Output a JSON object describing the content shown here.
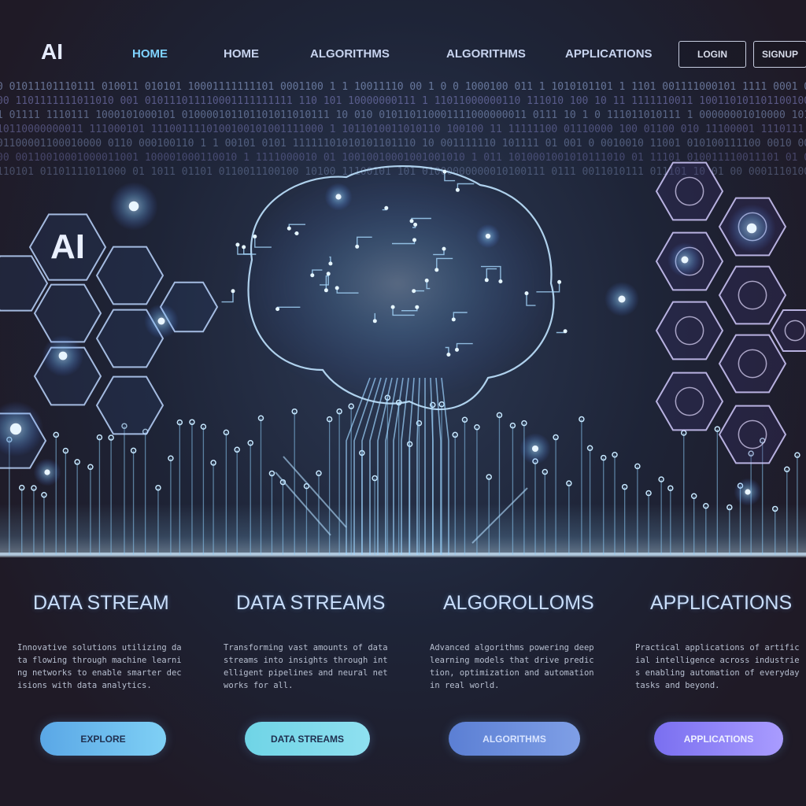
{
  "header": {
    "logo": "AI",
    "nav": [
      "HOME",
      "HOME",
      "ALGORITHMS",
      "ALGORITHMS",
      "APPLICATIONS"
    ],
    "buttons": [
      "LOGIN",
      "SIGNUP"
    ]
  },
  "hero": {
    "hex_badge": "AI"
  },
  "features": [
    {
      "title": "DATA STREAM",
      "description": "Innovative solutions utilizing data flowing through machine learning networks to enable smarter decisions with data analytics.",
      "button": "EXPLORE"
    },
    {
      "title": "DATA STREAMS",
      "description": "Transforming vast amounts of data streams into insights through intelligent pipelines and neural networks for all.",
      "button": "DATA STREAMS"
    },
    {
      "title": "ALGOROLLOMS",
      "description": "Advanced algorithms powering deep learning models that drive prediction, optimization and automation in real world.",
      "button": "ALGORITHMS"
    },
    {
      "title": "APPLICATIONS",
      "description": "Practical applications of artificial intelligence across industries enabling automation of everyday tasks and beyond.",
      "button": "APPLICATIONS"
    }
  ],
  "colors": {
    "background": "#1f1a26",
    "accent_cyan": "#7fd3ff",
    "accent_violet": "#8a7cf4",
    "circuit": "#a9d8ff"
  },
  "icons": [
    "brain-circuit-icon",
    "ai-hexagon-icon",
    "data-node-icon"
  ]
}
